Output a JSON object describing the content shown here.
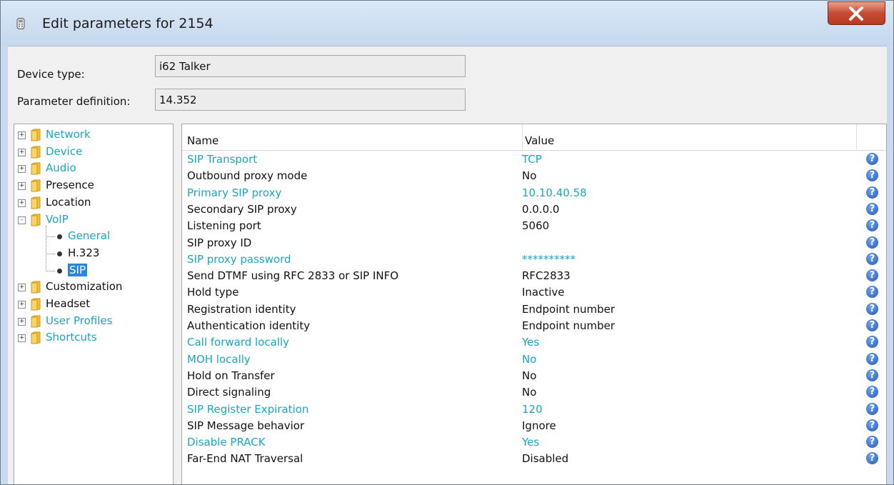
{
  "window": {
    "title": "Edit parameters for 2154"
  },
  "form": {
    "device_type_label": "Device type:",
    "device_type_value": "i62 Talker",
    "param_def_label": "Parameter definition:",
    "param_def_value": "14.352"
  },
  "tree": {
    "items": [
      {
        "label": "Network",
        "color": "cyan",
        "kind": "folder",
        "expander": "+"
      },
      {
        "label": "Device",
        "color": "cyan",
        "kind": "folder",
        "expander": "+"
      },
      {
        "label": "Audio",
        "color": "cyan",
        "kind": "folder",
        "expander": "+"
      },
      {
        "label": "Presence",
        "color": "dark",
        "kind": "folder",
        "expander": "+"
      },
      {
        "label": "Location",
        "color": "dark",
        "kind": "folder",
        "expander": "+"
      },
      {
        "label": "VoIP",
        "color": "cyan",
        "kind": "folder",
        "expander": "-"
      },
      {
        "label": "General",
        "color": "cyan",
        "kind": "leaf"
      },
      {
        "label": "H.323",
        "color": "dark",
        "kind": "leaf"
      },
      {
        "label": "SIP",
        "color": "selected",
        "kind": "leaf"
      },
      {
        "label": "Customization",
        "color": "dark",
        "kind": "folder",
        "expander": "+"
      },
      {
        "label": "Headset",
        "color": "dark",
        "kind": "folder",
        "expander": "+"
      },
      {
        "label": "User Profiles",
        "color": "cyan",
        "kind": "folder",
        "expander": "+"
      },
      {
        "label": "Shortcuts",
        "color": "cyan",
        "kind": "folder",
        "expander": "+"
      }
    ]
  },
  "table": {
    "headers": {
      "name": "Name",
      "value": "Value"
    },
    "help_glyph": "?",
    "rows": [
      {
        "name": "SIP Transport",
        "value": "TCP",
        "color": "cyan"
      },
      {
        "name": "Outbound proxy mode",
        "value": "No",
        "color": "dark"
      },
      {
        "name": "Primary SIP proxy",
        "value": "10.10.40.58",
        "color": "cyan"
      },
      {
        "name": "Secondary SIP proxy",
        "value": "0.0.0.0",
        "color": "dark"
      },
      {
        "name": "Listening port",
        "value": "5060",
        "color": "dark"
      },
      {
        "name": "SIP proxy ID",
        "value": "",
        "color": "dark"
      },
      {
        "name": "SIP proxy password",
        "value": "**********",
        "color": "cyan"
      },
      {
        "name": "Send DTMF using RFC 2833 or SIP INFO",
        "value": "RFC2833",
        "color": "dark"
      },
      {
        "name": "Hold type",
        "value": "Inactive",
        "color": "dark"
      },
      {
        "name": "Registration identity",
        "value": "Endpoint number",
        "color": "dark"
      },
      {
        "name": "Authentication identity",
        "value": "Endpoint number",
        "color": "dark"
      },
      {
        "name": "Call forward locally",
        "value": "Yes",
        "color": "cyan"
      },
      {
        "name": "MOH locally",
        "value": "No",
        "color": "cyan"
      },
      {
        "name": "Hold on Transfer",
        "value": "No",
        "color": "dark"
      },
      {
        "name": "Direct signaling",
        "value": "No",
        "color": "dark"
      },
      {
        "name": "SIP Register Expiration",
        "value": "120",
        "color": "cyan"
      },
      {
        "name": "SIP Message behavior",
        "value": "Ignore",
        "color": "dark"
      },
      {
        "name": "Disable PRACK",
        "value": "Yes",
        "color": "cyan"
      },
      {
        "name": "Far-End NAT Traversal",
        "value": "Disabled",
        "color": "dark"
      }
    ]
  },
  "colors": {
    "modified_text": "#1aa6bf",
    "selection": "#2b86d9",
    "title_bg": "#c9daee"
  }
}
